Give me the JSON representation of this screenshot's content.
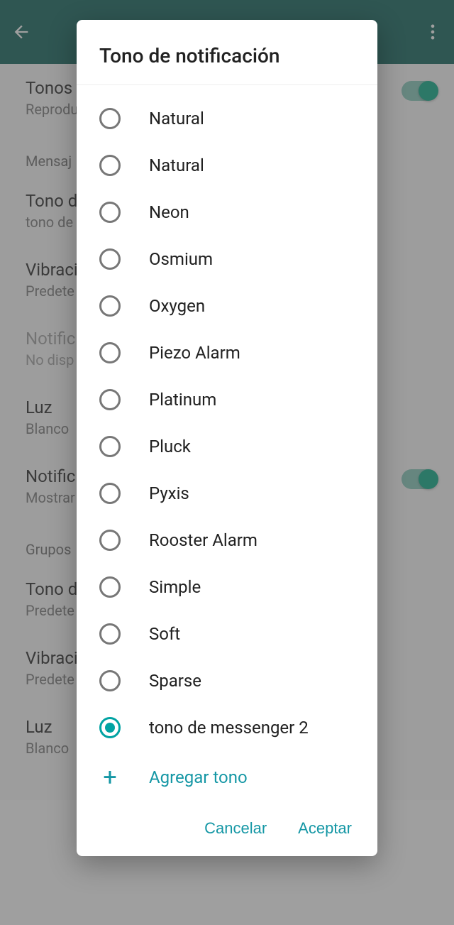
{
  "colors": {
    "primary": "#075e54",
    "accent": "#00a884",
    "dialog_accent": "#1597a5"
  },
  "background": {
    "sections": {
      "item_tones": {
        "title": "Tonos",
        "subtitle": "Reprodu\nsaliente"
      },
      "section_messages": "Mensaj",
      "item_tone": {
        "title": "Tono d",
        "subtitle": "tono de"
      },
      "item_vibrate": {
        "title": "Vibraci",
        "subtitle": "Predete"
      },
      "item_disabled": {
        "title": "Notific",
        "subtitle": "No disp"
      },
      "item_light": {
        "title": "Luz",
        "subtitle": "Blanco"
      },
      "item_notif2": {
        "title": "Notific",
        "subtitle": "Mostrar\nsuperio"
      },
      "section_groups": "Grupos",
      "item_tone2": {
        "title": "Tono d",
        "subtitle": "Predete"
      },
      "item_vibrate2": {
        "title": "Vibraci",
        "subtitle": "Predete"
      },
      "item_light2": {
        "title": "Luz",
        "subtitle": "Blanco"
      }
    }
  },
  "dialog": {
    "title": "Tono de notificación",
    "tones": [
      {
        "label": "Natural",
        "selected": false
      },
      {
        "label": "Natural",
        "selected": false
      },
      {
        "label": "Neon",
        "selected": false
      },
      {
        "label": "Osmium",
        "selected": false
      },
      {
        "label": "Oxygen",
        "selected": false
      },
      {
        "label": "Piezo Alarm",
        "selected": false
      },
      {
        "label": "Platinum",
        "selected": false
      },
      {
        "label": "Pluck",
        "selected": false
      },
      {
        "label": "Pyxis",
        "selected": false
      },
      {
        "label": "Rooster Alarm",
        "selected": false
      },
      {
        "label": "Simple",
        "selected": false
      },
      {
        "label": "Soft",
        "selected": false
      },
      {
        "label": "Sparse",
        "selected": false
      },
      {
        "label": "tono de messenger 2",
        "selected": true
      }
    ],
    "add_label": "Agregar tono",
    "cancel_label": "Cancelar",
    "accept_label": "Aceptar"
  }
}
